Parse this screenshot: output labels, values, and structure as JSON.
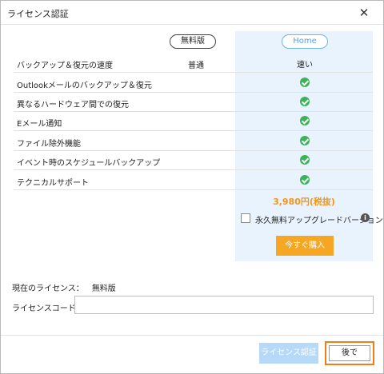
{
  "window": {
    "title": "ライセンス認証"
  },
  "plans": {
    "free": "無料版",
    "home": "Home"
  },
  "features": [
    {
      "label": "バックアップ＆復元の速度",
      "free": "普通",
      "home": "速い",
      "home_check": false
    },
    {
      "label": "Outlookメールのバックアップ＆復元",
      "free": "",
      "home": "",
      "home_check": true
    },
    {
      "label": "異なるハードウェア間での復元",
      "free": "",
      "home": "",
      "home_check": true
    },
    {
      "label": "Eメール通知",
      "free": "",
      "home": "",
      "home_check": true
    },
    {
      "label": "ファイル除外機能",
      "free": "",
      "home": "",
      "home_check": true
    },
    {
      "label": "イベント時のスケジュールバックアップ",
      "free": "",
      "home": "",
      "home_check": true
    },
    {
      "label": "テクニカルサポート",
      "free": "",
      "home": "",
      "home_check": true
    }
  ],
  "price": "3,980円(税抜)",
  "upgrade": {
    "label": "永久無料アップグレードバージョン",
    "checked": false,
    "info_icon": "info-icon"
  },
  "buy_label": "今すぐ購入",
  "license": {
    "current_label": "現在のライセンス：",
    "current_value": "無料版",
    "code_label": "ライセンスコード：",
    "code_value": ""
  },
  "buttons": {
    "activate": "ライセンス認証",
    "later": "後で"
  },
  "colors": {
    "accent": "#f5a623",
    "check": "#3cb35a",
    "home_bg": "#e8f3fd",
    "activate_disabled": "#b6d9f7",
    "focus_border": "#f07d18"
  }
}
